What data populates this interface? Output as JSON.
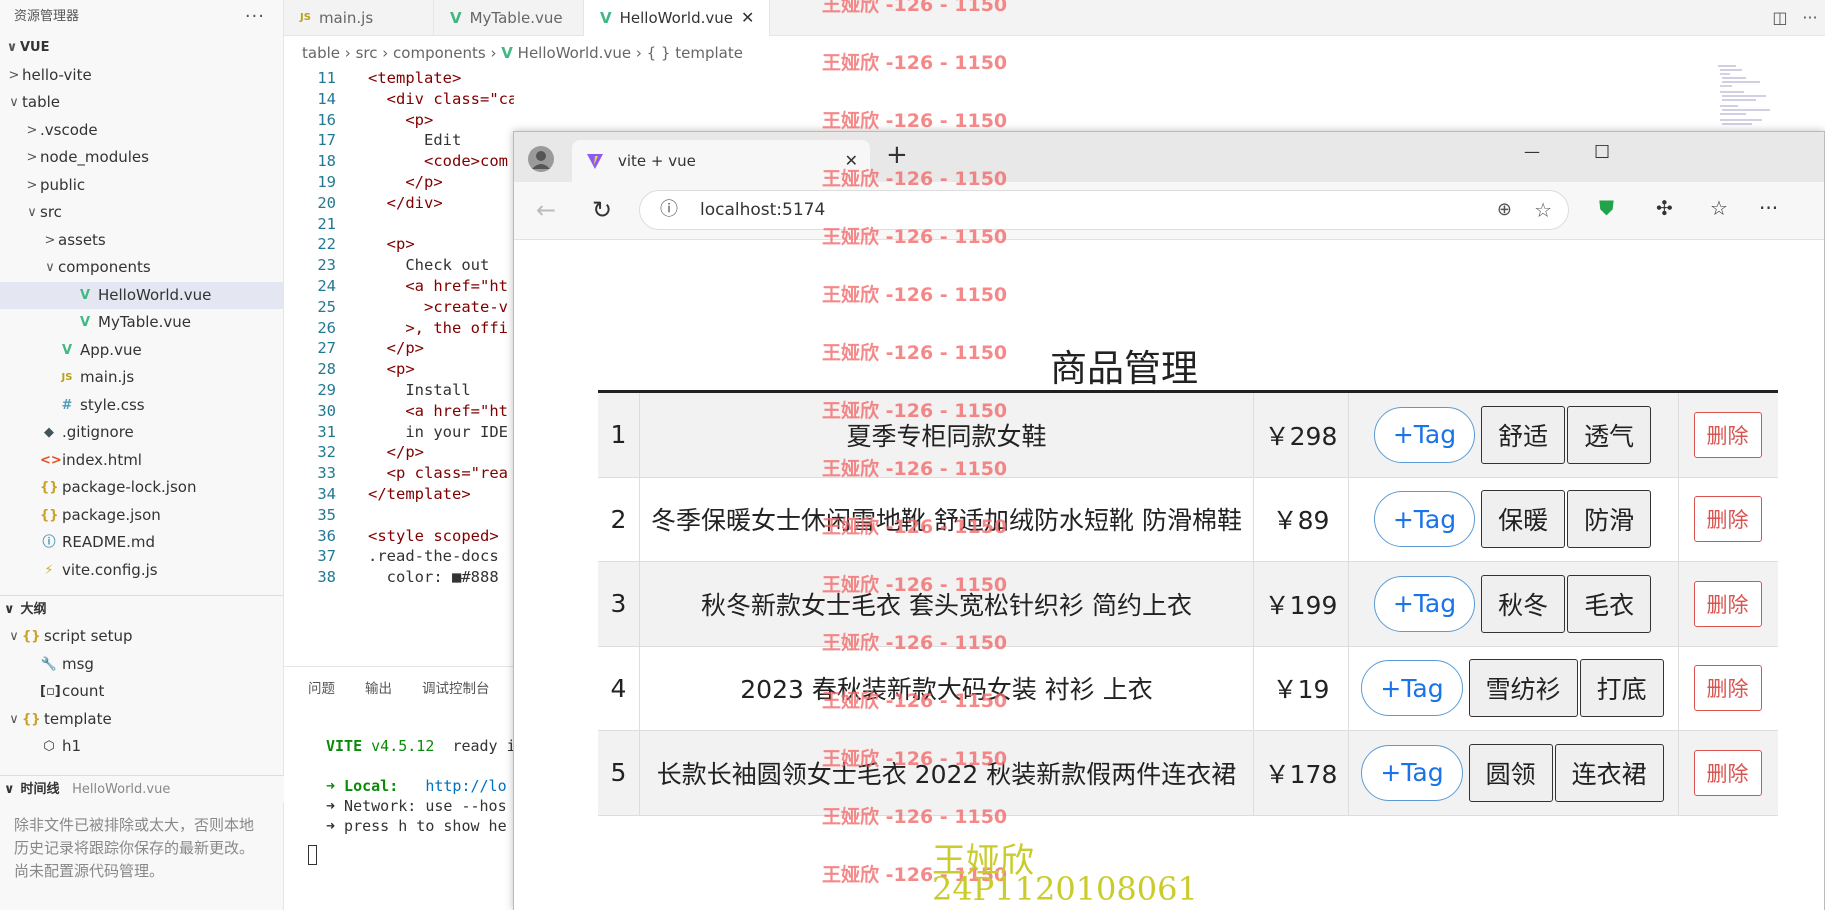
{
  "explorer": {
    "title": "资源管理器",
    "more": "···",
    "root": "VUE",
    "items": [
      {
        "label": "hello-vite",
        "chev": ">",
        "icon": "",
        "indent": 0
      },
      {
        "label": "table",
        "chev": "∨",
        "icon": "",
        "indent": 0
      },
      {
        "label": ".vscode",
        "chev": ">",
        "icon": "",
        "indent": 1
      },
      {
        "label": "node_modules",
        "chev": ">",
        "icon": "",
        "indent": 1
      },
      {
        "label": "public",
        "chev": ">",
        "icon": "",
        "indent": 1
      },
      {
        "label": "src",
        "chev": "∨",
        "icon": "",
        "indent": 1
      },
      {
        "label": "assets",
        "chev": ">",
        "icon": "",
        "indent": 2
      },
      {
        "label": "components",
        "chev": "∨",
        "icon": "",
        "indent": 2
      },
      {
        "label": "HelloWorld.vue",
        "chev": "",
        "icon": "V",
        "indent": 3
      },
      {
        "label": "MyTable.vue",
        "chev": "",
        "icon": "V",
        "indent": 3
      },
      {
        "label": "App.vue",
        "chev": "",
        "icon": "V",
        "indent": 2
      },
      {
        "label": "main.js",
        "chev": "",
        "icon": "JS",
        "indent": 2
      },
      {
        "label": "style.css",
        "chev": "",
        "icon": "#",
        "indent": 2
      },
      {
        "label": ".gitignore",
        "chev": "",
        "icon": "◆",
        "indent": 1
      },
      {
        "label": "index.html",
        "chev": "",
        "icon": "<>",
        "indent": 1
      },
      {
        "label": "package-lock.json",
        "chev": "",
        "icon": "{}",
        "indent": 1
      },
      {
        "label": "package.json",
        "chev": "",
        "icon": "{}",
        "indent": 1
      },
      {
        "label": "README.md",
        "chev": "",
        "icon": "ⓘ",
        "indent": 1
      },
      {
        "label": "vite.config.js",
        "chev": "",
        "icon": "⚡",
        "indent": 1
      }
    ],
    "outline_title": "大纲",
    "outline": [
      {
        "label": "script setup",
        "chev": "∨",
        "icon": "{}",
        "indent": 0
      },
      {
        "label": "msg",
        "chev": "",
        "icon": "🔧",
        "indent": 1
      },
      {
        "label": "count",
        "chev": "",
        "icon": "[▫]",
        "indent": 1
      },
      {
        "label": "template",
        "chev": "∨",
        "icon": "{}",
        "indent": 0
      },
      {
        "label": "h1",
        "chev": "",
        "icon": "⬡",
        "indent": 1
      }
    ],
    "timeline_title": "时间线",
    "timeline_file": "HelloWorld.vue",
    "timeline_msg": "除非文件已被排除或太大，否则本地历史记录将跟踪你保存的最新更改。 尚未配置源代码管理。"
  },
  "tabs": [
    {
      "label": "main.js",
      "icon": "JS"
    },
    {
      "label": "MyTable.vue",
      "icon": "V"
    },
    {
      "label": "HelloWorld.vue",
      "icon": "V",
      "close": "✕"
    }
  ],
  "breadcrumb": {
    "p1": "table",
    "p2": "src",
    "p3": "components",
    "p4": "HelloWorld.vue",
    "p5": "{ } template"
  },
  "code": [
    {
      "n": "11",
      "t": "<template>"
    },
    {
      "n": "14",
      "t": "  <div class=\"card\">"
    },
    {
      "n": "16",
      "t": "    <p>"
    },
    {
      "n": "17",
      "t": "      Edit"
    },
    {
      "n": "18",
      "t": "      <code>com"
    },
    {
      "n": "19",
      "t": "    </p>"
    },
    {
      "n": "20",
      "t": "  </div>"
    },
    {
      "n": "21",
      "t": ""
    },
    {
      "n": "22",
      "t": "  <p>"
    },
    {
      "n": "23",
      "t": "    Check out"
    },
    {
      "n": "24",
      "t": "    <a href=\"ht"
    },
    {
      "n": "25",
      "t": "      >create-v"
    },
    {
      "n": "26",
      "t": "    >, the offi"
    },
    {
      "n": "27",
      "t": "  </p>"
    },
    {
      "n": "28",
      "t": "  <p>"
    },
    {
      "n": "29",
      "t": "    Install"
    },
    {
      "n": "30",
      "t": "    <a href=\"ht"
    },
    {
      "n": "31",
      "t": "    in your IDE"
    },
    {
      "n": "32",
      "t": "  </p>"
    },
    {
      "n": "33",
      "t": "  <p class=\"rea"
    },
    {
      "n": "34",
      "t": "</template>"
    },
    {
      "n": "35",
      "t": ""
    },
    {
      "n": "36",
      "t": "<style scoped>"
    },
    {
      "n": "37",
      "t": ".read-the-docs"
    },
    {
      "n": "38",
      "t": "  color: ■#888"
    }
  ],
  "panel": {
    "tab1": "问题",
    "tab2": "输出",
    "tab3": "调试控制台",
    "vite": "VITE",
    "version": "v4.5.12",
    "ready": "ready i",
    "local_label": "➜ Local:",
    "local_url": "http://lo",
    "network": "➜ Network: use --hos",
    "help": "➜ press h to show he"
  },
  "browser": {
    "tab_title": "vite + vue",
    "tab_close": "✕",
    "new_tab": "+",
    "minimize": "—",
    "maximize": "☐",
    "url": "localhost:5174"
  },
  "page": {
    "title": "商品管理",
    "tag_button": "+Tag",
    "delete_button": "删除",
    "rows": [
      {
        "id": "1",
        "name": "夏季专柜同款女鞋",
        "price": "￥298",
        "tags": [
          "舒适",
          "透气"
        ]
      },
      {
        "id": "2",
        "name": "冬季保暖女士休闲雪地靴 舒适加绒防水短靴 防滑棉鞋",
        "price": "￥89",
        "tags": [
          "保暖",
          "防滑"
        ]
      },
      {
        "id": "3",
        "name": "秋冬新款女士毛衣 套头宽松针织衫 简约上衣",
        "price": "￥199",
        "tags": [
          "秋冬",
          "毛衣"
        ]
      },
      {
        "id": "4",
        "name": "2023 春秋装新款大码女装 衬衫 上衣",
        "price": "￥19",
        "tags": [
          "雪纺衫",
          "打底"
        ]
      },
      {
        "id": "5",
        "name": "长款长袖圆领女士毛衣 2022 秋装新款假两件连衣裙",
        "price": "￥178",
        "tags": [
          "圆领",
          "连衣裙"
        ]
      }
    ]
  },
  "watermark": {
    "text": "王娅欣 -126 - 1150",
    "sig_name": "王娅欣",
    "sig_id": "24P1120108061"
  }
}
